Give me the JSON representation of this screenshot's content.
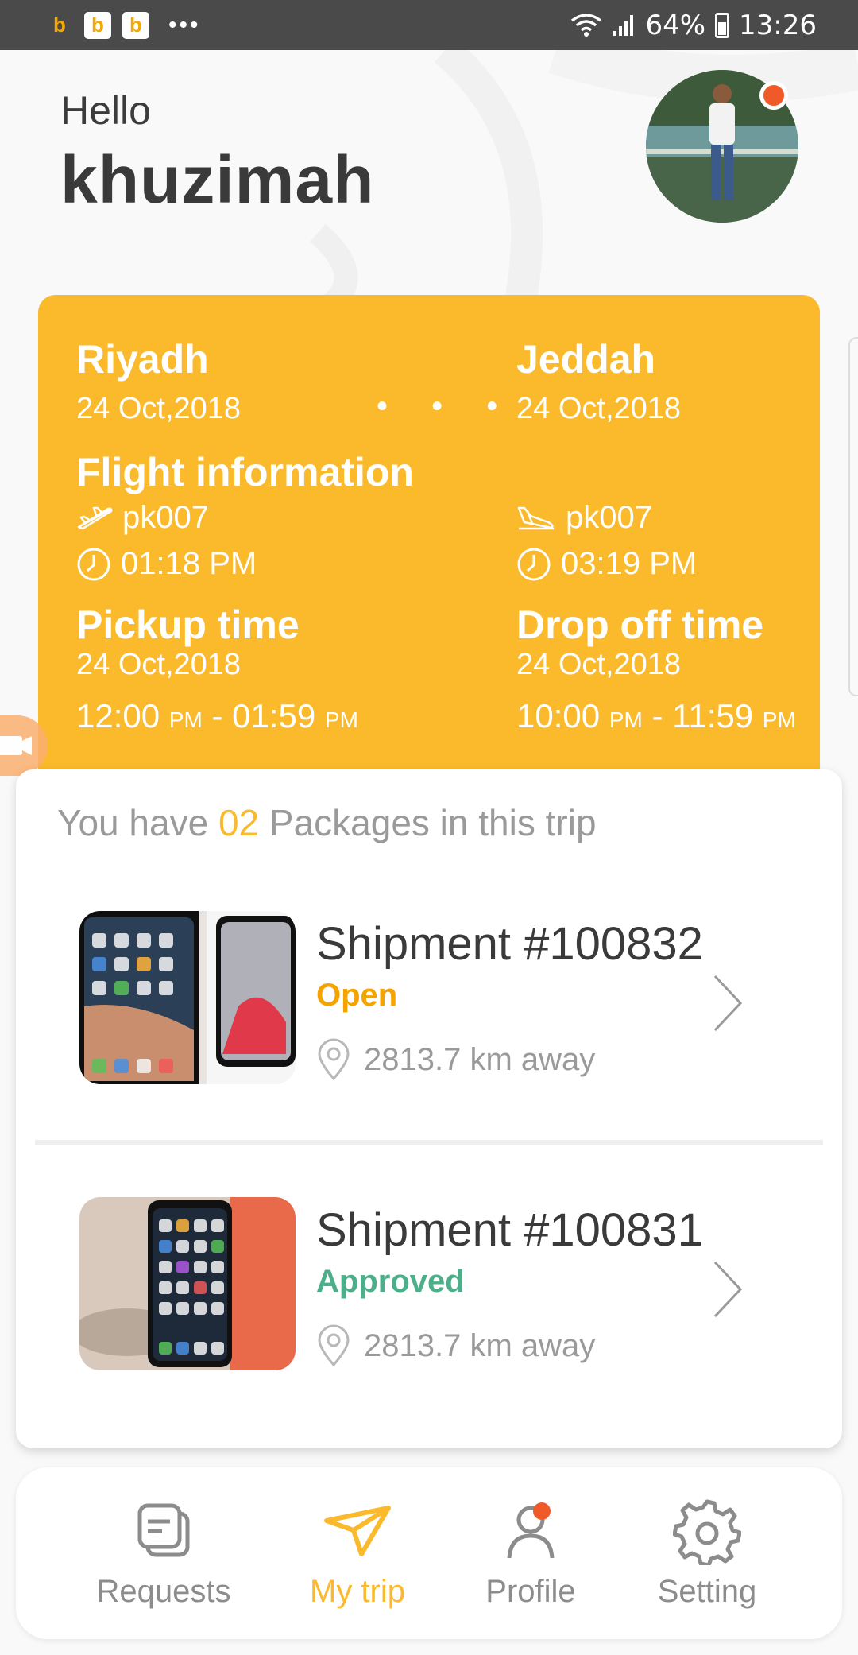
{
  "status_bar": {
    "notif_icon_glyph": "b",
    "more_glyph": "•••",
    "battery": "64%",
    "time": "13:26"
  },
  "header": {
    "greeting": "Hello",
    "username": "khuzimah"
  },
  "trip": {
    "origin": {
      "city": "Riyadh",
      "date": "24 Oct,2018",
      "flight_no": "pk007",
      "time": "01:18 PM"
    },
    "destination": {
      "city": "Jeddah",
      "date": "24 Oct,2018",
      "flight_no": "pk007",
      "time": "03:19 PM"
    },
    "route_dots": "• • •",
    "flight_info_label": "Flight information",
    "pickup": {
      "label": "Pickup time",
      "date": "24 Oct,2018",
      "start": "12:00",
      "start_ampm": "PM",
      "sep": " - ",
      "end": "01:59",
      "end_ampm": "PM"
    },
    "dropoff": {
      "label": "Drop off time",
      "date": "24 Oct,2018",
      "start": "10:00",
      "start_ampm": "PM",
      "sep": " - ",
      "end": "11:59",
      "end_ampm": "PM"
    }
  },
  "packages": {
    "prefix": "You have",
    "count": "02",
    "suffix": "Packages in this trip",
    "items": [
      {
        "name": "Shipment #100832",
        "status": "Open",
        "status_color": "#f5a300",
        "distance": "2813.7 km away"
      },
      {
        "name": "Shipment #100831",
        "status": "Approved",
        "status_color": "#4caf8a",
        "distance": "2813.7 km away"
      }
    ]
  },
  "nav": {
    "items": [
      {
        "label": "Requests",
        "icon": "requests-icon"
      },
      {
        "label": "My trip",
        "icon": "send-plane-icon"
      },
      {
        "label": "Profile",
        "icon": "profile-icon"
      },
      {
        "label": "Setting",
        "icon": "gear-icon"
      }
    ],
    "active_color": "#fbb92c"
  },
  "colors": {
    "accent": "#fbb92c",
    "alert": "#f05a28"
  }
}
